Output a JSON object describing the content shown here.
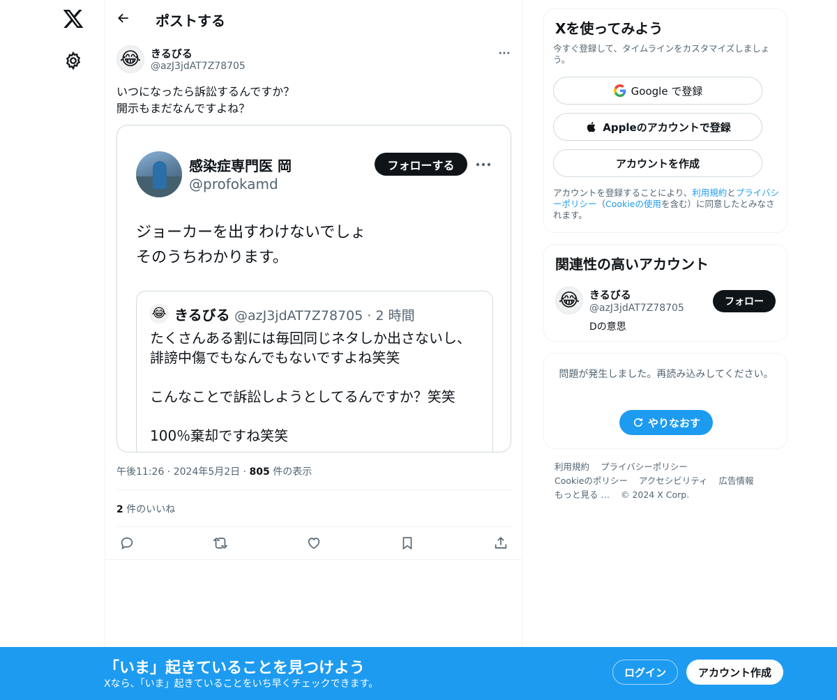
{
  "nav": {
    "logo_icon": "x-logo-icon",
    "settings_icon": "gear-icon"
  },
  "header": {
    "title": "ポストする"
  },
  "post": {
    "author_name": "きるびる",
    "author_handle": "@azJ3jdAT7Z78705",
    "avatar_emoji": "😂",
    "text_line1": "いつになったら訴訟するんですか？",
    "text_line2": "開示もまだなんですよね？",
    "time": "午後11:26",
    "date": "2024年5月2日",
    "views_count": "805",
    "views_label": "件の表示",
    "likes_count": "2",
    "likes_label": "件のいいね"
  },
  "media": {
    "name": "感染症専門医 岡",
    "handle": "@profokamd",
    "follow_label": "フォローする",
    "text_line1": "ジョーカーを出すわけないでしょ",
    "text_line2": "そのうちわかります。",
    "quote": {
      "avatar_emoji": "😂",
      "name": "きるびる",
      "meta": "@azJ3jdAT7Z78705 · 2 時間",
      "body_line1": "たくさんある割には毎回同じネタしか出さないし、",
      "body_line2": "誹謗中傷でもなんでもないですよね笑笑",
      "body_line3": "こんなことで訴訟しようとしてるんですか？笑笑",
      "body_line4": "100％棄却ですね笑笑"
    }
  },
  "signup": {
    "title": "Xを使ってみよう",
    "subtitle": "今すぐ登録して、タイムラインをカスタマイズしましょう。",
    "google_label": "Google で登録",
    "apple_label": "Appleのアカウントで登録",
    "create_label": "アカウントを作成",
    "legal_pre": "アカウントを登録することにより、",
    "legal_terms": "利用規約",
    "legal_and": "と",
    "legal_privacy": "プライバシーポリシー",
    "legal_paren_open": "（",
    "legal_cookie": "Cookieの使用",
    "legal_post": "を含む）に同意したとみなされます。"
  },
  "related": {
    "title": "関連性の高いアカウント",
    "avatar_emoji": "😂",
    "name": "きるびる",
    "handle": "@azJ3jdAT7Z78705",
    "bio": "Dの意思",
    "follow_label": "フォロー"
  },
  "error": {
    "message": "問題が発生しました。再読み込みしてください。",
    "retry_label": "やりなおす"
  },
  "footer": {
    "links": [
      "利用規約",
      "プライバシーポリシー",
      "Cookieのポリシー",
      "アクセシビリティ",
      "広告情報",
      "もっと見る …",
      "© 2024 X Corp."
    ]
  },
  "banner": {
    "title": "「いま」起きていることを見つけよう",
    "subtitle": "Xなら、「いま」起きていることをいち早くチェックできます。",
    "login_label": "ログイン",
    "signup_label": "アカウント作成"
  },
  "colors": {
    "accent": "#1d9bf0",
    "text": "#0f1419",
    "secondary": "#536471",
    "border": "#cfd9de"
  }
}
